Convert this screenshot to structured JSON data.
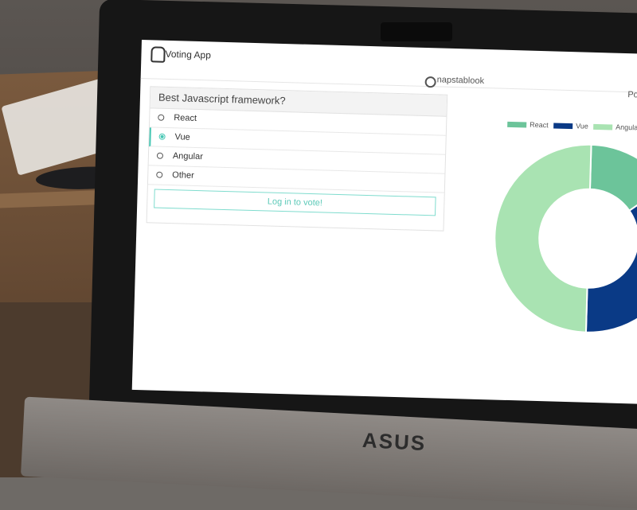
{
  "app": {
    "title": "Voting App",
    "github_user": "napstablook",
    "nav_right_text": "Po"
  },
  "poll": {
    "question": "Best Javascript framework?",
    "options": [
      {
        "label": "React",
        "selected": false
      },
      {
        "label": "Vue",
        "selected": true
      },
      {
        "label": "Angular",
        "selected": false
      },
      {
        "label": "Other",
        "selected": false
      }
    ],
    "login_button_label": "Log in to vote!"
  },
  "chart_data": {
    "type": "pie",
    "style": "doughnut",
    "legend_position": "top",
    "labels": [
      "React",
      "Vue",
      "Angular"
    ],
    "values": [
      15,
      35,
      50
    ],
    "colors": [
      "#6cc49a",
      "#0a3a86",
      "#a9e3b2"
    ]
  },
  "device": {
    "brand": "ASUS"
  },
  "icons": {
    "logo": "ghost-logo-icon",
    "github": "github-icon"
  }
}
